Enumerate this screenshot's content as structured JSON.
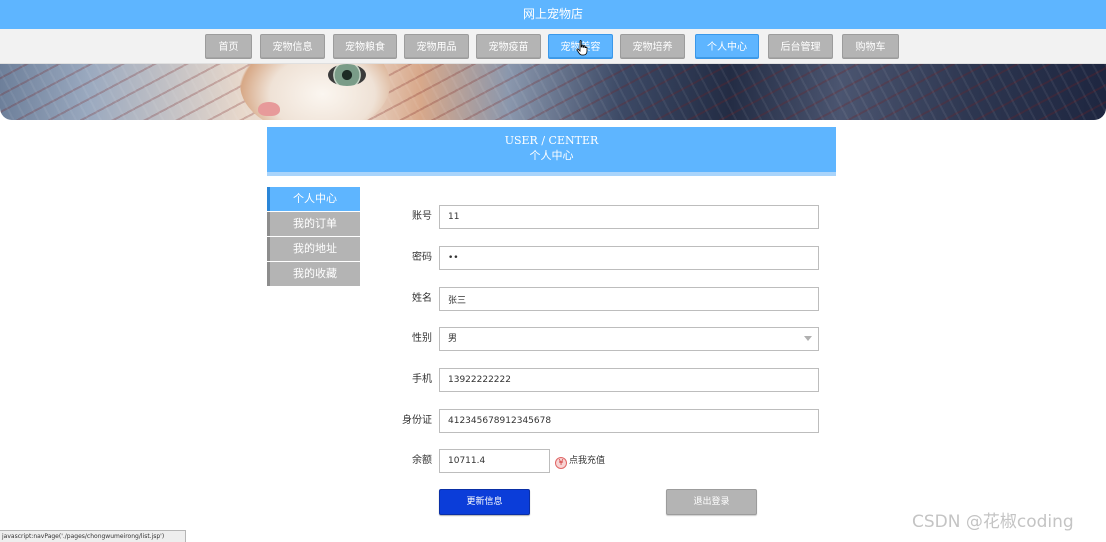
{
  "site": {
    "title": "网上宠物店"
  },
  "nav": {
    "items": [
      {
        "label": "首页"
      },
      {
        "label": "宠物信息"
      },
      {
        "label": "宠物粮食"
      },
      {
        "label": "宠物用品"
      },
      {
        "label": "宠物疫苗"
      },
      {
        "label": "宠物美容",
        "hovered": true
      },
      {
        "label": "宠物培养"
      },
      {
        "label": "个人中心",
        "active": true
      },
      {
        "label": "后台管理"
      },
      {
        "label": "购物车"
      }
    ]
  },
  "heading": {
    "en": "USER / CENTER",
    "cn": "个人中心"
  },
  "side_menu": {
    "items": [
      {
        "label": "个人中心",
        "active": true
      },
      {
        "label": "我的订单"
      },
      {
        "label": "我的地址"
      },
      {
        "label": "我的收藏"
      }
    ]
  },
  "form": {
    "account": {
      "label": "账号",
      "value": "11"
    },
    "password": {
      "label": "密码",
      "value": "••"
    },
    "name": {
      "label": "姓名",
      "value": "张三"
    },
    "gender": {
      "label": "性别",
      "value": "男"
    },
    "phone": {
      "label": "手机",
      "value": "13922222222"
    },
    "id_card": {
      "label": "身份证",
      "value": "412345678912345678"
    },
    "balance": {
      "label": "余额",
      "value": "10711.4",
      "recharge_label": "点我充值",
      "recharge_icon": "yen-icon"
    }
  },
  "buttons": {
    "update": "更新信息",
    "logout": "退出登录"
  },
  "status_bar": {
    "text": "javascript:navPage('./pages/chongwumeirong/list.jsp')"
  },
  "watermark": {
    "text": "CSDN @花椒coding"
  },
  "colors": {
    "primary": "#5eb5ff",
    "update_button": "#0b3dd9",
    "inactive": "#b4b4b4"
  }
}
